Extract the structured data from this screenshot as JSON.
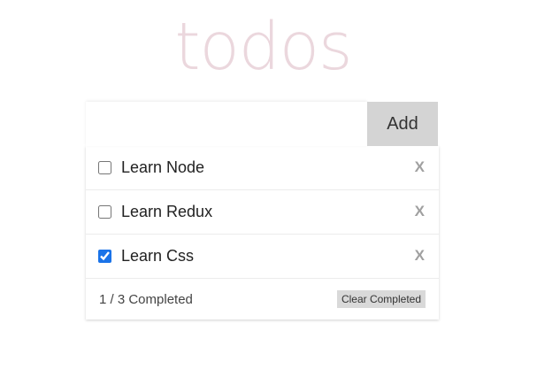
{
  "header": {
    "title": "todos"
  },
  "entry": {
    "value": "",
    "placeholder": "",
    "add_label": "Add"
  },
  "todos": [
    {
      "label": "Learn Node",
      "completed": false,
      "delete_label": "X"
    },
    {
      "label": "Learn Redux",
      "completed": false,
      "delete_label": "X"
    },
    {
      "label": "Learn Css",
      "completed": true,
      "delete_label": "X"
    }
  ],
  "footer": {
    "count_text": "1 / 3 Completed",
    "clear_label": "Clear Completed"
  },
  "colors": {
    "title": "#ebd7dd",
    "add_button_bg": "#d4d4d4",
    "clear_button_bg": "#d9d9d9",
    "delete_x": "#a0a0a0",
    "checkbox_accent": "#1a73e8"
  }
}
